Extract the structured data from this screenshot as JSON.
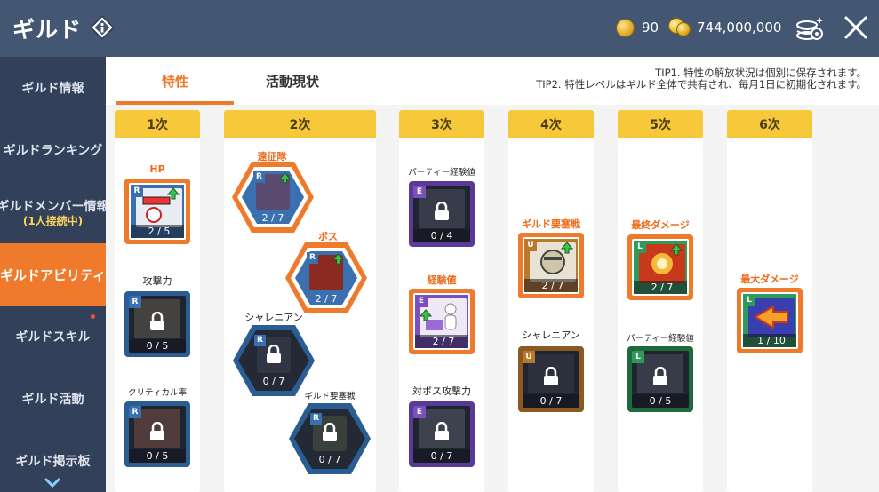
{
  "header": {
    "title": "ギルド",
    "currency_a": "90",
    "currency_b": "744,000,000"
  },
  "sidebar": {
    "items": [
      {
        "label": "ギルド情報"
      },
      {
        "label": "ギルドランキング"
      },
      {
        "label": "ギルドメンバー情報",
        "sub": "(1人接続中)"
      },
      {
        "label": "ギルドアビリティ"
      },
      {
        "label": "ギルドスキル"
      },
      {
        "label": "ギルド活動"
      },
      {
        "label": "ギルド掲示板"
      }
    ]
  },
  "tabs": [
    {
      "label": "特性"
    },
    {
      "label": "活動現状"
    }
  ],
  "tips": {
    "tip1": "TIP1. 特性の解放状況は個別に保存されます。",
    "tip2": "TIP2. 特性レベルはギルド全体で共有され、毎月1日に初期化されます。"
  },
  "columns": [
    {
      "label": "1次"
    },
    {
      "label": "2次"
    },
    {
      "label": "3次"
    },
    {
      "label": "4次"
    },
    {
      "label": "5次"
    },
    {
      "label": "6次"
    }
  ],
  "skills": {
    "hp": {
      "name": "HP",
      "level": "2 / 5",
      "grade": "R"
    },
    "atk": {
      "name": "攻撃力",
      "level": "0 / 5",
      "grade": "R"
    },
    "crit": {
      "name": "クリティカル率",
      "level": "0 / 5",
      "grade": "R"
    },
    "expedition": {
      "name": "遠征隊",
      "level": "2 / 7",
      "grade": "R"
    },
    "boss": {
      "name": "ボス",
      "level": "2 / 7",
      "grade": "R"
    },
    "sharenian2": {
      "name": "シャレニアン",
      "level": "0 / 7",
      "grade": "R"
    },
    "siege2": {
      "name": "ギルド要塞戦",
      "level": "0 / 7",
      "grade": "R"
    },
    "party_exp3": {
      "name": "パーティー経験値",
      "level": "0 / 4",
      "grade": "E"
    },
    "exp": {
      "name": "経験値",
      "level": "2 / 7",
      "grade": "E"
    },
    "boss_atk": {
      "name": "対ボス攻撃力",
      "level": "0 / 7",
      "grade": "E"
    },
    "siege4": {
      "name": "ギルド要塞戦",
      "level": "2 / 7",
      "grade": "U"
    },
    "sharenian4": {
      "name": "シャレニアン",
      "level": "0 / 7",
      "grade": "U"
    },
    "final_dmg": {
      "name": "最終ダメージ",
      "level": "2 / 7",
      "grade": "L"
    },
    "party_exp5": {
      "name": "パーティー経験値",
      "level": "0 / 5",
      "grade": "L"
    },
    "max_dmg": {
      "name": "最大ダメージ",
      "level": "1 / 10",
      "grade": "L"
    }
  },
  "colors": {
    "header_bg": "#445772",
    "sidebar_bg": "#33405a",
    "active_orange": "#f07a2c",
    "column_header": "#f7c93a",
    "grade_r": "#3a6fb0",
    "grade_e": "#7a4fc0",
    "grade_u": "#b87a2a",
    "grade_l": "#2f9a5a"
  }
}
